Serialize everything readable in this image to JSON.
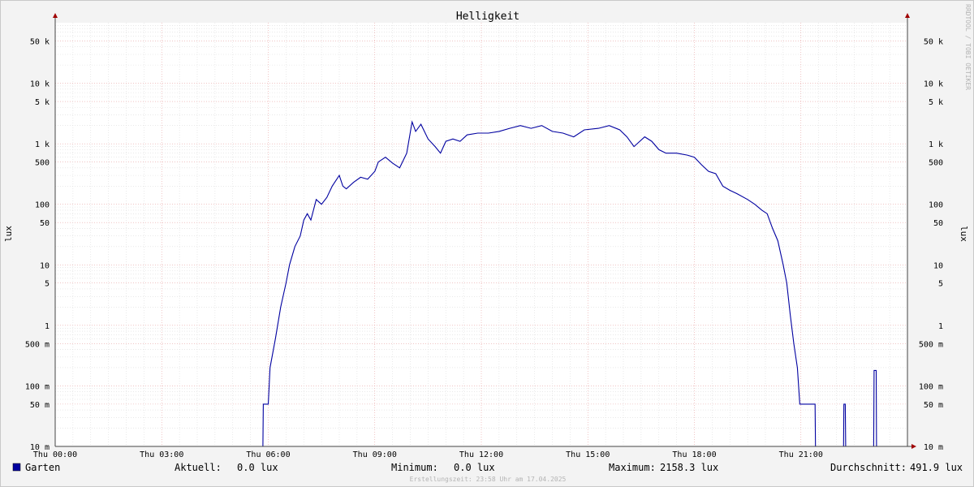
{
  "chart_data": {
    "type": "line",
    "title": "Helligkeit",
    "ylabel": "lux",
    "yscale": "log",
    "ylim": [
      0.01,
      100000
    ],
    "xlim_hours": [
      0,
      24
    ],
    "x_ticks": [
      {
        "hour": 0,
        "label": "Thu 00:00"
      },
      {
        "hour": 3,
        "label": "Thu 03:00"
      },
      {
        "hour": 6,
        "label": "Thu 06:00"
      },
      {
        "hour": 9,
        "label": "Thu 09:00"
      },
      {
        "hour": 12,
        "label": "Thu 12:00"
      },
      {
        "hour": 15,
        "label": "Thu 15:00"
      },
      {
        "hour": 18,
        "label": "Thu 18:00"
      },
      {
        "hour": 21,
        "label": "Thu 21:00"
      }
    ],
    "y_ticks": [
      {
        "value": 0.01,
        "label": "10 m"
      },
      {
        "value": 0.05,
        "label": "50 m"
      },
      {
        "value": 0.1,
        "label": "100 m"
      },
      {
        "value": 0.5,
        "label": "500 m"
      },
      {
        "value": 1,
        "label": "1"
      },
      {
        "value": 5,
        "label": "5"
      },
      {
        "value": 10,
        "label": "10"
      },
      {
        "value": 50,
        "label": "50"
      },
      {
        "value": 100,
        "label": "100"
      },
      {
        "value": 500,
        "label": "500"
      },
      {
        "value": 1000,
        "label": "1 k"
      },
      {
        "value": 5000,
        "label": "5 k"
      },
      {
        "value": 10000,
        "label": "10 k"
      },
      {
        "value": 50000,
        "label": "50 k"
      }
    ],
    "grid": true,
    "series": [
      {
        "name": "Garten",
        "color": "#0000a0",
        "points": [
          [
            0,
            0.01
          ],
          [
            5.85,
            0.01
          ],
          [
            5.86,
            0.05
          ],
          [
            6.0,
            0.05
          ],
          [
            6.05,
            0.2
          ],
          [
            6.2,
            0.6
          ],
          [
            6.35,
            2.0
          ],
          [
            6.5,
            5
          ],
          [
            6.6,
            10
          ],
          [
            6.75,
            20
          ],
          [
            6.9,
            30
          ],
          [
            7.0,
            55
          ],
          [
            7.1,
            70
          ],
          [
            7.2,
            55
          ],
          [
            7.35,
            120
          ],
          [
            7.5,
            100
          ],
          [
            7.65,
            130
          ],
          [
            7.8,
            200
          ],
          [
            8.0,
            300
          ],
          [
            8.1,
            200
          ],
          [
            8.2,
            180
          ],
          [
            8.4,
            230
          ],
          [
            8.6,
            280
          ],
          [
            8.8,
            260
          ],
          [
            9.0,
            350
          ],
          [
            9.1,
            500
          ],
          [
            9.3,
            600
          ],
          [
            9.5,
            480
          ],
          [
            9.7,
            400
          ],
          [
            9.9,
            700
          ],
          [
            10.05,
            2300
          ],
          [
            10.15,
            1600
          ],
          [
            10.3,
            2100
          ],
          [
            10.5,
            1200
          ],
          [
            10.7,
            900
          ],
          [
            10.85,
            700
          ],
          [
            11.0,
            1100
          ],
          [
            11.2,
            1200
          ],
          [
            11.4,
            1100
          ],
          [
            11.6,
            1400
          ],
          [
            11.9,
            1500
          ],
          [
            12.2,
            1500
          ],
          [
            12.5,
            1600
          ],
          [
            12.8,
            1800
          ],
          [
            13.1,
            2000
          ],
          [
            13.4,
            1800
          ],
          [
            13.7,
            2000
          ],
          [
            14.0,
            1600
          ],
          [
            14.3,
            1500
          ],
          [
            14.6,
            1300
          ],
          [
            14.9,
            1700
          ],
          [
            15.3,
            1800
          ],
          [
            15.6,
            2000
          ],
          [
            15.9,
            1700
          ],
          [
            16.1,
            1300
          ],
          [
            16.3,
            900
          ],
          [
            16.6,
            1300
          ],
          [
            16.8,
            1100
          ],
          [
            17.0,
            800
          ],
          [
            17.2,
            700
          ],
          [
            17.5,
            700
          ],
          [
            17.8,
            650
          ],
          [
            18.0,
            600
          ],
          [
            18.2,
            450
          ],
          [
            18.4,
            350
          ],
          [
            18.6,
            320
          ],
          [
            18.8,
            200
          ],
          [
            19.0,
            170
          ],
          [
            19.2,
            150
          ],
          [
            19.5,
            120
          ],
          [
            19.7,
            100
          ],
          [
            19.9,
            80
          ],
          [
            20.05,
            70
          ],
          [
            20.2,
            40
          ],
          [
            20.35,
            25
          ],
          [
            20.5,
            10
          ],
          [
            20.6,
            5
          ],
          [
            20.7,
            1.5
          ],
          [
            20.8,
            0.5
          ],
          [
            20.9,
            0.2
          ],
          [
            20.97,
            0.05
          ],
          [
            21.4,
            0.05
          ],
          [
            21.41,
            0.01
          ],
          [
            22.2,
            0.01
          ],
          [
            22.21,
            0.05
          ],
          [
            22.25,
            0.05
          ],
          [
            22.26,
            0.01
          ],
          [
            23.05,
            0.01
          ],
          [
            23.06,
            0.18
          ],
          [
            23.12,
            0.18
          ],
          [
            23.13,
            0.01
          ],
          [
            24.0,
            0.01
          ]
        ]
      }
    ],
    "legend": [
      {
        "name": "Garten",
        "color": "#0000a0"
      }
    ],
    "stats": {
      "current_label": "Aktuell:",
      "current_value": "0.0 lux",
      "min_label": "Minimum:",
      "min_value": "0.0 lux",
      "max_label": "Maximum:",
      "max_value": "2158.3 lux",
      "avg_label": "Durchschnitt:",
      "avg_value": "491.9 lux"
    },
    "footer": "Erstellungszeit: 23:58 Uhr am 17.04.2025",
    "watermark": "RRDTOOL / TOBI OETIKER",
    "colors": {
      "background": "#f3f3f3",
      "canvas": "#ffffff",
      "major_grid": "#e8a0a0",
      "minor_grid": "#dcdcdc",
      "axis": "#a00000",
      "line": "#0000a0"
    }
  }
}
